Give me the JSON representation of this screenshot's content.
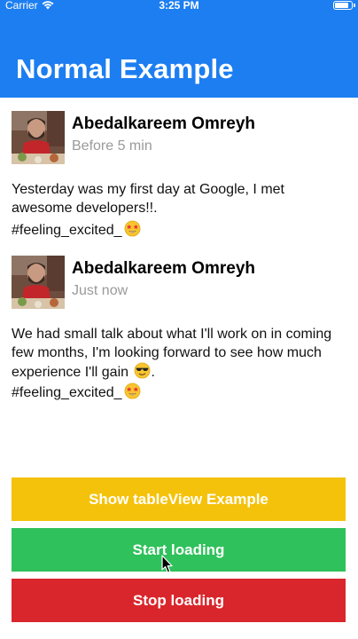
{
  "status_bar": {
    "carrier": "Carrier",
    "time": "3:25 PM"
  },
  "nav": {
    "title": "Normal Example"
  },
  "posts": [
    {
      "author": "Abedalkareem Omreyh",
      "time": "Before 5 min",
      "text": "Yesterday was my first day at Google, I met awesome developers!!.",
      "tags": "#feeling_excited_",
      "tags_emoji": "star-struck-emoji"
    },
    {
      "author": "Abedalkareem Omreyh",
      "time": "Just now",
      "text": "We had small talk about what I'll work on in coming few months, I'm looking forward to see how much experience I'll gain",
      "text_emoji": "sunglasses-emoji",
      "text_suffix": ".",
      "tags": "#feeling_excited_",
      "tags_emoji": "star-struck-emoji"
    }
  ],
  "buttons": {
    "table_view": "Show tableView Example",
    "start_loading": "Start loading",
    "stop_loading": "Stop loading"
  },
  "colors": {
    "header": "#1c7ef1",
    "table_view_button": "#f5c20b",
    "start_button": "#2fc15b",
    "stop_button": "#d9262c",
    "time_text": "#9a9a9a"
  }
}
